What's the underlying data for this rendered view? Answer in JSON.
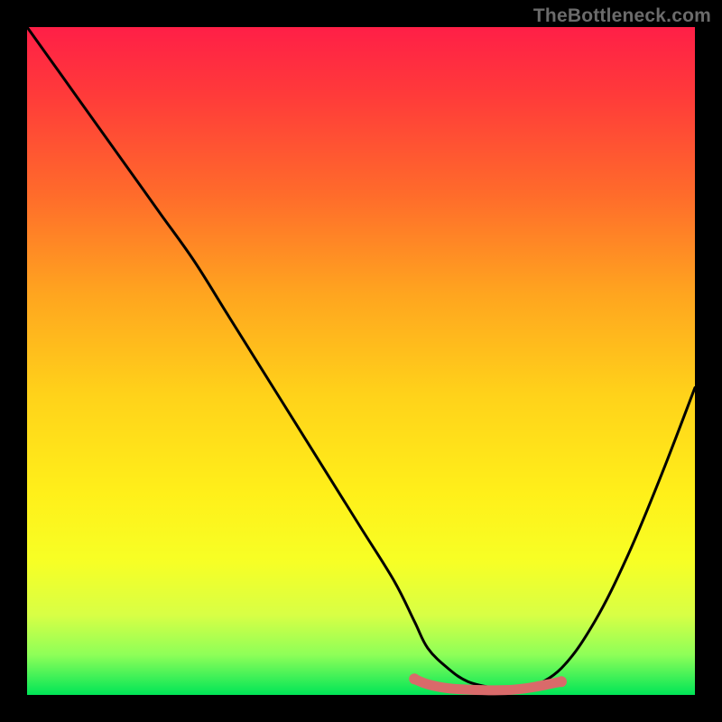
{
  "watermark": "TheBottleneck.com",
  "chart_data": {
    "type": "line",
    "title": "",
    "xlabel": "",
    "ylabel": "",
    "xlim": [
      0,
      100
    ],
    "ylim": [
      0,
      100
    ],
    "series": [
      {
        "name": "curve",
        "x": [
          0,
          5,
          10,
          15,
          20,
          25,
          30,
          35,
          40,
          45,
          50,
          55,
          58,
          60,
          63,
          66,
          70,
          72,
          75,
          80,
          85,
          90,
          95,
          100
        ],
        "values": [
          100,
          93,
          86,
          79,
          72,
          65,
          57,
          49,
          41,
          33,
          25,
          17,
          11,
          7,
          4,
          2,
          1,
          0.7,
          1,
          4,
          11,
          21,
          33,
          46
        ]
      },
      {
        "name": "highlight-band",
        "x": [
          58,
          60,
          63,
          66,
          70,
          73,
          76,
          80
        ],
        "values": [
          2.4,
          1.6,
          1.0,
          0.8,
          0.7,
          0.8,
          1.2,
          2.0
        ]
      }
    ],
    "colors": {
      "curve": "#000000",
      "highlight": "#d96a6a",
      "gradient_top": "#ff1f47",
      "gradient_bottom": "#00e557"
    }
  }
}
